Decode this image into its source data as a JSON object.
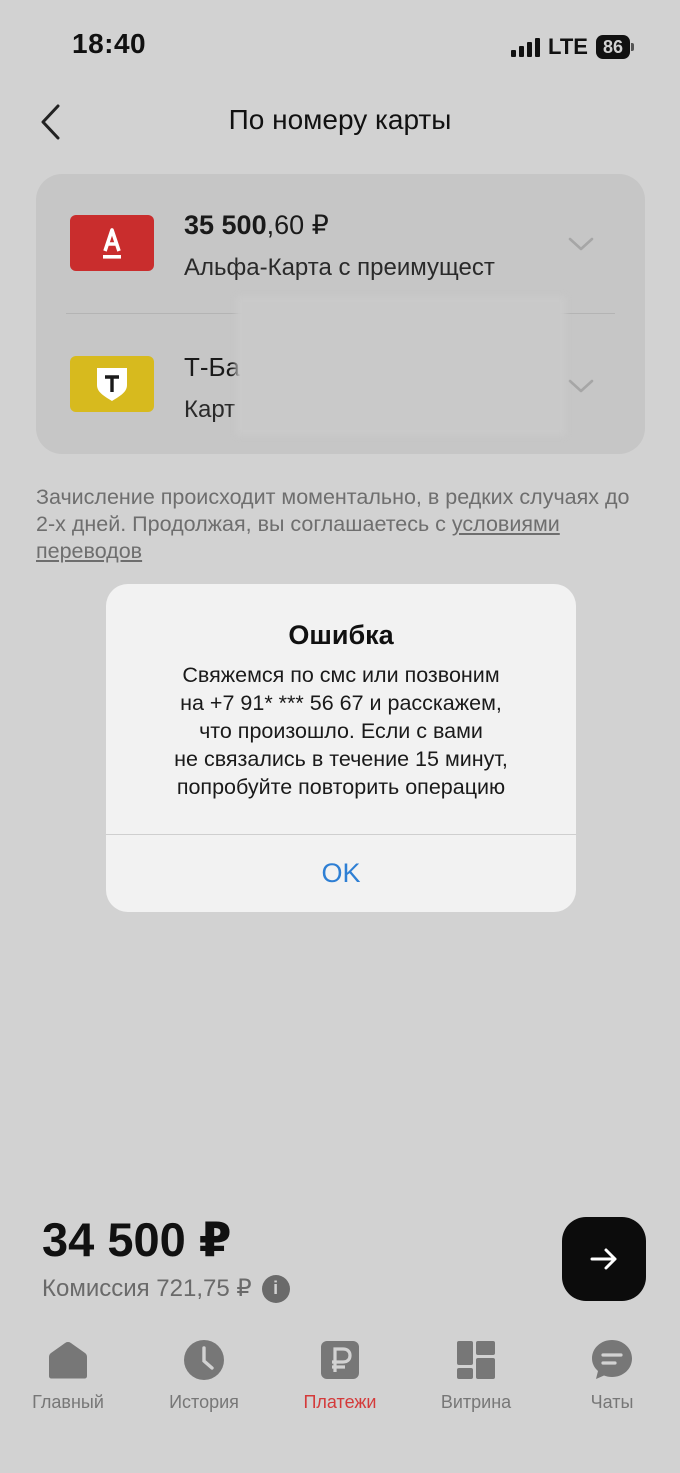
{
  "status_bar": {
    "time": "18:40",
    "network": "LTE",
    "battery": "86"
  },
  "header": {
    "title": "По номеру карты"
  },
  "cards": [
    {
      "amount_int": "35 500",
      "amount_frac": ",60 ₽",
      "name": "Альфа-Карта с преимущест",
      "logo_letter": "А"
    },
    {
      "amount_int": "Т-Ба",
      "amount_frac": "",
      "name": "Карт",
      "logo_letter": "Т"
    }
  ],
  "note": {
    "text": "Зачисление происходит моментально, в редких случаях до 2-х дней. Продолжая, вы соглашаетесь с ",
    "link": "условиями переводов"
  },
  "alert": {
    "title": "Ошибка",
    "lines": [
      "Свяжемся по смс или позвоним",
      "на +7 91* *** 56 67 и расскажем,",
      "что произошло. Если с вами",
      "не связались в течение 15 минут,",
      "попробуйте повторить операцию"
    ],
    "ok": "OK"
  },
  "transfer": {
    "total": "34 500 ₽",
    "fee": "Комиссия 721,75 ₽",
    "info": "i"
  },
  "tabs": [
    {
      "label": "Главный",
      "icon": "home-icon"
    },
    {
      "label": "История",
      "icon": "clock-icon"
    },
    {
      "label": "Платежи",
      "icon": "ruble-icon",
      "active": true
    },
    {
      "label": "Витрина",
      "icon": "grid-icon"
    },
    {
      "label": "Чаты",
      "icon": "chat-icon"
    }
  ],
  "colors": {
    "accent": "#d43a3a",
    "alert_button": "#2e7fd4",
    "alfa": "#c92d2d",
    "tbank": "#d7ba1e"
  }
}
